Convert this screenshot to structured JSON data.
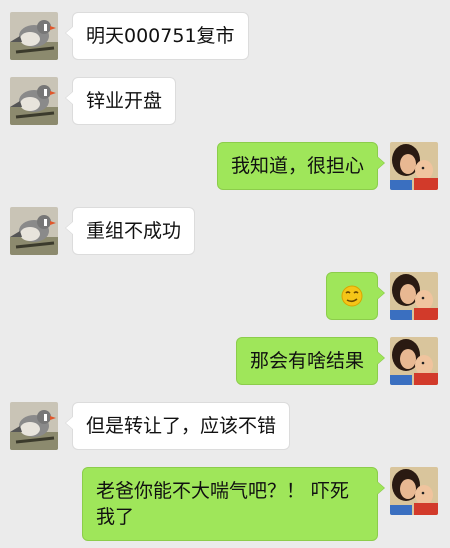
{
  "messages": [
    {
      "side": "left",
      "text": "明天000751复市"
    },
    {
      "side": "left",
      "text": "锌业开盘"
    },
    {
      "side": "right",
      "text": "我知道，很担心"
    },
    {
      "side": "left",
      "text": "重组不成功"
    },
    {
      "side": "right",
      "text": "",
      "emoji": "smirk-emoji"
    },
    {
      "side": "right",
      "text": "那会有啥结果"
    },
    {
      "side": "left",
      "text": "但是转让了，应该不错"
    },
    {
      "side": "right",
      "text": "老爸你能不大喘气吧？！ 吓死我了"
    }
  ],
  "avatars": {
    "left": "bird-avatar",
    "right": "mother-child-avatar"
  },
  "colors": {
    "background": "#ebebeb",
    "bubble_left": "#ffffff",
    "bubble_right": "#9fe65a"
  }
}
